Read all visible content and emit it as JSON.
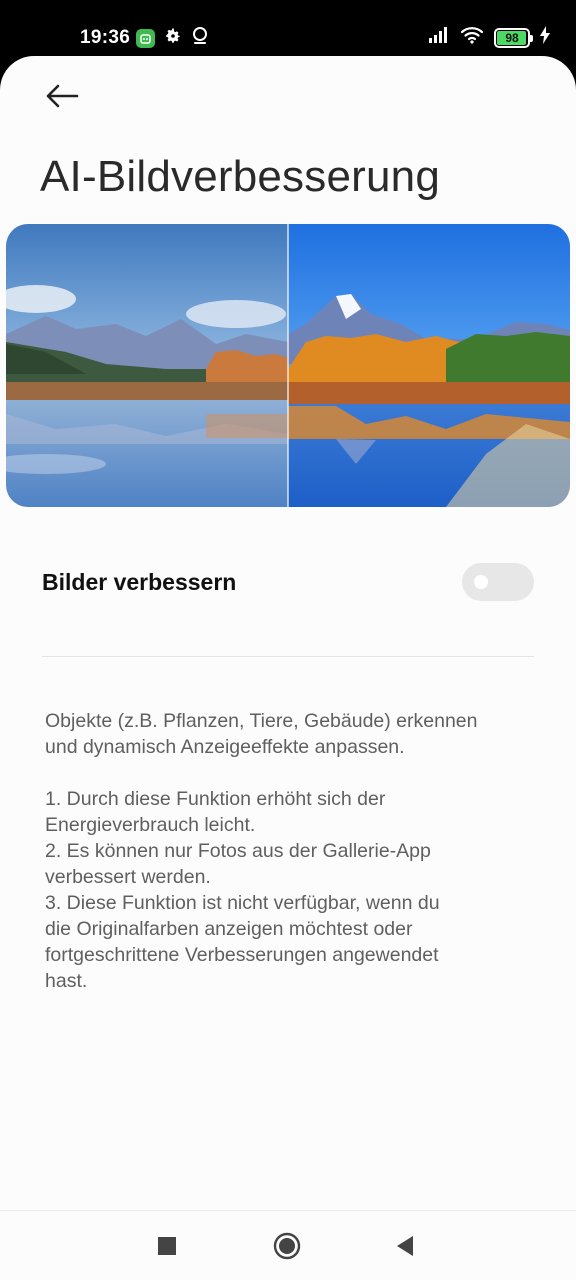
{
  "status_bar": {
    "time": "19:36",
    "battery_level": "98",
    "battery_fraction": 0.98,
    "left_icons": [
      "app-notification-icon",
      "gear-icon",
      "location-icon"
    ],
    "right_icons": [
      "signal-icon",
      "wifi-icon",
      "battery-icon",
      "charging-icon"
    ]
  },
  "header": {
    "back_icon": "arrow-left-icon",
    "title": "AI-Bildverbesserung"
  },
  "preview": {
    "description_icon": "before-after-landscape-image",
    "divider_position": 0.5
  },
  "settings": {
    "toggle_label": "Bilder verbessern",
    "toggle_on": false
  },
  "description": {
    "intro_line1": "Objekte (z.B. Pflanzen, Tiere, Gebäude) erkennen",
    "intro_line2": "und dynamisch Anzeigeeffekte anpassen.",
    "item1_line1": "1. Durch diese Funktion erhöht sich der",
    "item1_line2": "Energieverbrauch leicht.",
    "item2_line1": "2. Es können nur Fotos aus der Gallerie-App",
    "item2_line2": "verbessert werden.",
    "item3_line1": "3. Diese Funktion ist nicht verfügbar, wenn du",
    "item3_line2": "die Originalfarben anzeigen möchtest oder",
    "item3_line3": "fortgeschrittene Verbesserungen angewendet",
    "item3_line4": "hast."
  },
  "nav_bar": {
    "icons": [
      "recents-square-icon",
      "home-circle-icon",
      "back-triangle-icon"
    ]
  },
  "colors": {
    "accent_sky": "#3a8ee6",
    "toggle_off": "#e7e7e7",
    "title_text": "#2a2a2a"
  }
}
